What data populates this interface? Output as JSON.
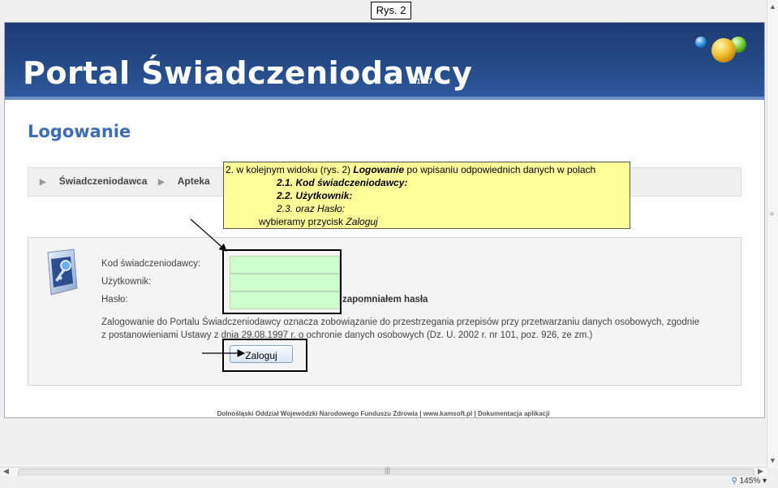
{
  "caption": "Rys. 2",
  "portal": {
    "title": "Portal Świadczeniodawcy",
    "version": "2.1917"
  },
  "page_title": "Logowanie",
  "tabs": [
    {
      "label": "Świadczeniodawca"
    },
    {
      "label": "Apteka"
    }
  ],
  "form": {
    "kod_label": "Kod świadczeniodawcy:",
    "kod_value": "",
    "user_label": "Użytkownik:",
    "user_value": "",
    "pass_label": "Hasło:",
    "pass_value": "",
    "forgot_link": "zapomniałem hasła",
    "notice": "Zalogowanie do Portalu Świadczeniodawcy oznacza zobowiązanie do przestrzegania przepisów przy przetwarzaniu danych osobowych, zgodnie z postanowieniami Ustawy z dnia 29.08.1997 r. o ochronie danych osobowych (Dz. U. 2002 r. nr 101, poz. 926, ze zm.)",
    "login_button": "Zaloguj"
  },
  "footer": "Dolnośląski Oddział Wojewódzki Narodowego Funduszu Zdrowia | www.kamsoft.pl | Dokumentacja aplikacji",
  "statusbar": {
    "zoom": "145%"
  },
  "annotation": {
    "line1_prefix": "2.   w kolejnym widoku (rys. 2) ",
    "line1_em": "Logowanie",
    "line1_suffix": " po wpisaniu odpowiednich danych w polach",
    "line2": "2.1. Kod świadczeniodawcy:",
    "line3": "2.2. Użytkownik:",
    "line4": "2.3. oraz Hasło:",
    "line5_prefix": "wybieramy przycisk ",
    "line5_em": "Zaloguj"
  },
  "colors": {
    "banner": "#244a88",
    "title_blue": "#3b6db3",
    "input_green": "#ccffcc",
    "annotation_yellow": "#ffff99"
  }
}
